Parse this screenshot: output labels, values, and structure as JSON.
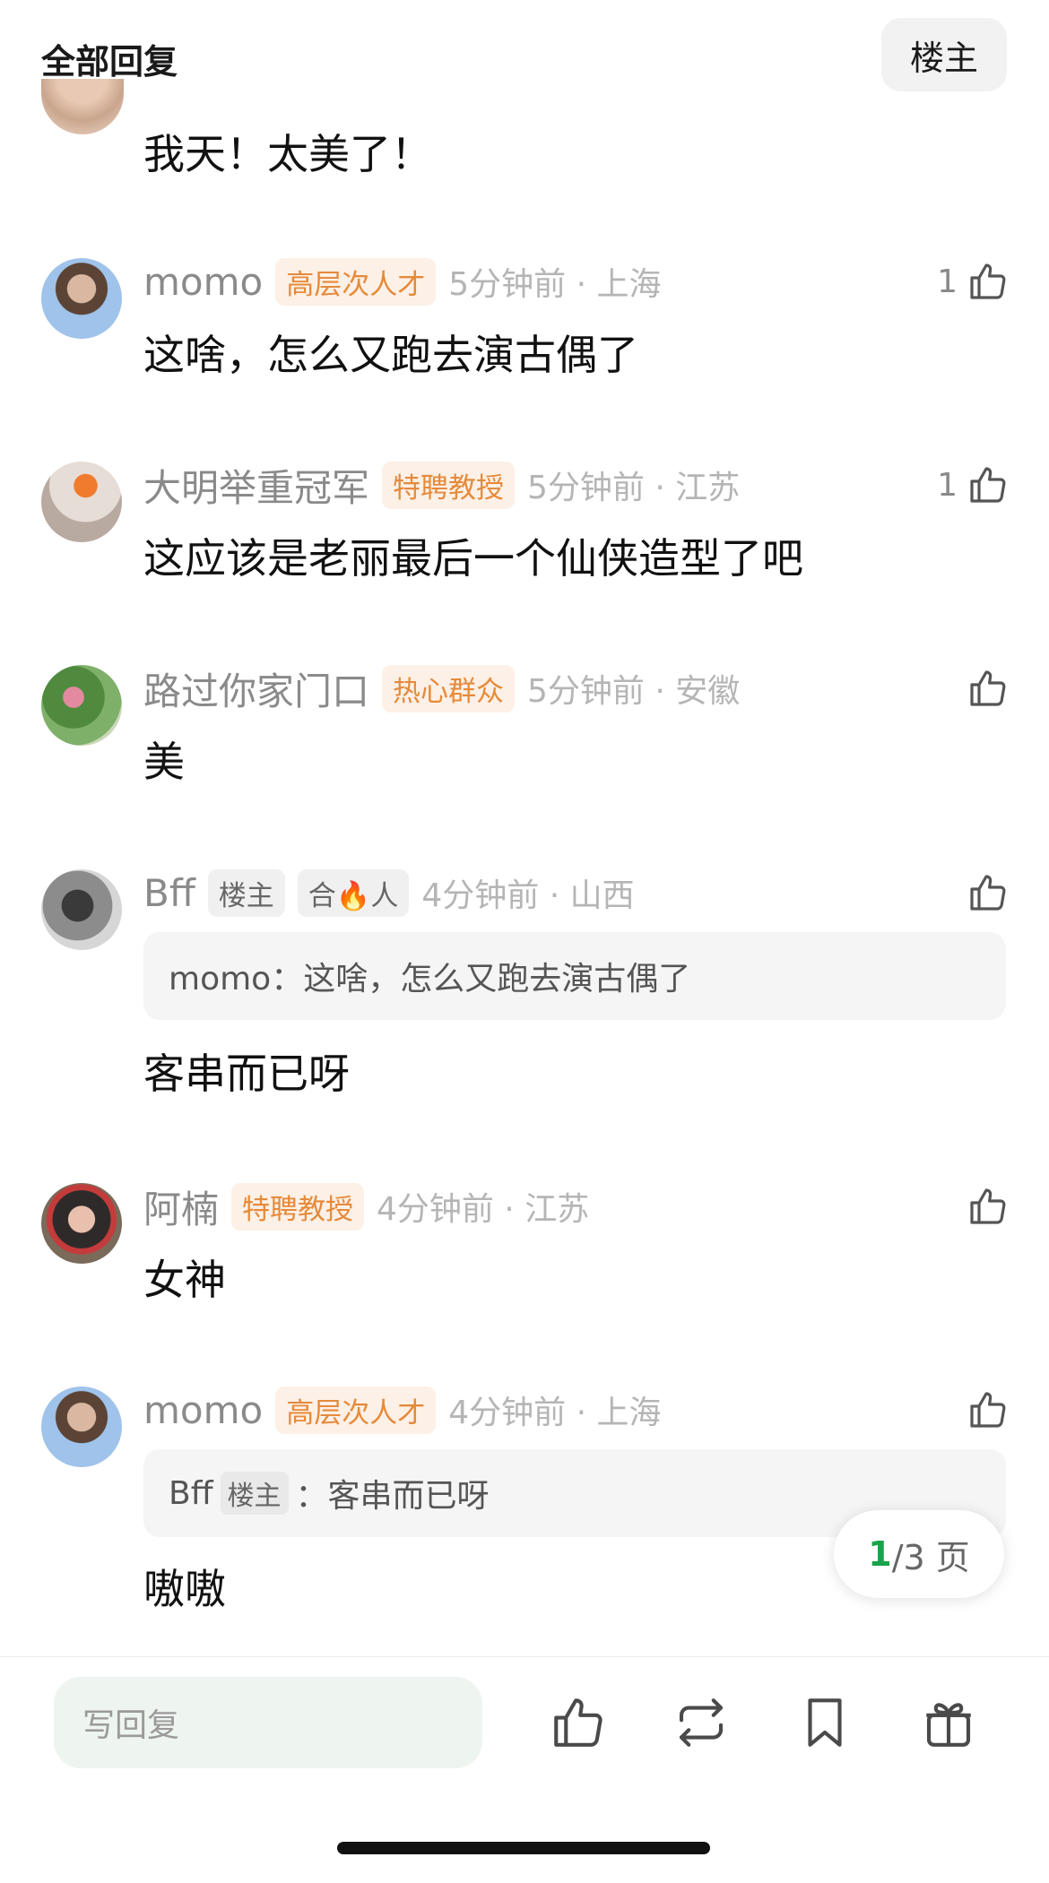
{
  "header": {
    "title": "全部回复",
    "owner_button": "楼主"
  },
  "first_comment": {
    "text": "我天！太美了！"
  },
  "comments": [
    {
      "username": "momo",
      "badges": [
        "高层次人才"
      ],
      "meta": "5分钟前 · 上海",
      "likes": "1",
      "text": "这啥，怎么又跑去演古偶了"
    },
    {
      "username": "大明举重冠军",
      "badges": [
        "特聘教授"
      ],
      "meta": "5分钟前 · 江苏",
      "likes": "1",
      "text": "这应该是老丽最后一个仙侠造型了吧"
    },
    {
      "username": "路过你家门口",
      "badges": [
        "热心群众"
      ],
      "meta": "5分钟前 · 安徽",
      "likes": "",
      "text": "美"
    },
    {
      "username": "Bff",
      "badges": [
        "楼主",
        "合🔥人"
      ],
      "meta": "4分钟前 · 山西",
      "likes": "",
      "quote": "momo：这啥，怎么又跑去演古偶了",
      "text": "客串而已呀"
    },
    {
      "username": "阿楠",
      "badges": [
        "特聘教授"
      ],
      "meta": "4分钟前 · 江苏",
      "likes": "",
      "text": "女神"
    },
    {
      "username": "momo",
      "badges": [
        "高层次人才"
      ],
      "meta": "4分钟前 · 上海",
      "likes": "",
      "quote_user": "Bff",
      "quote_badge": "楼主",
      "quote_sep": "：",
      "quote_text": "客串而已呀",
      "text": "嗷嗷"
    }
  ],
  "pagination": {
    "current": "1",
    "total": "/3 页"
  },
  "bottom_bar": {
    "reply_placeholder": "写回复"
  },
  "colors": {
    "badge_orange": "#e58a3a",
    "page_current": "#1aa34a"
  },
  "icons": [
    "thumbs-up-icon",
    "repost-icon",
    "bookmark-icon",
    "gift-icon"
  ]
}
